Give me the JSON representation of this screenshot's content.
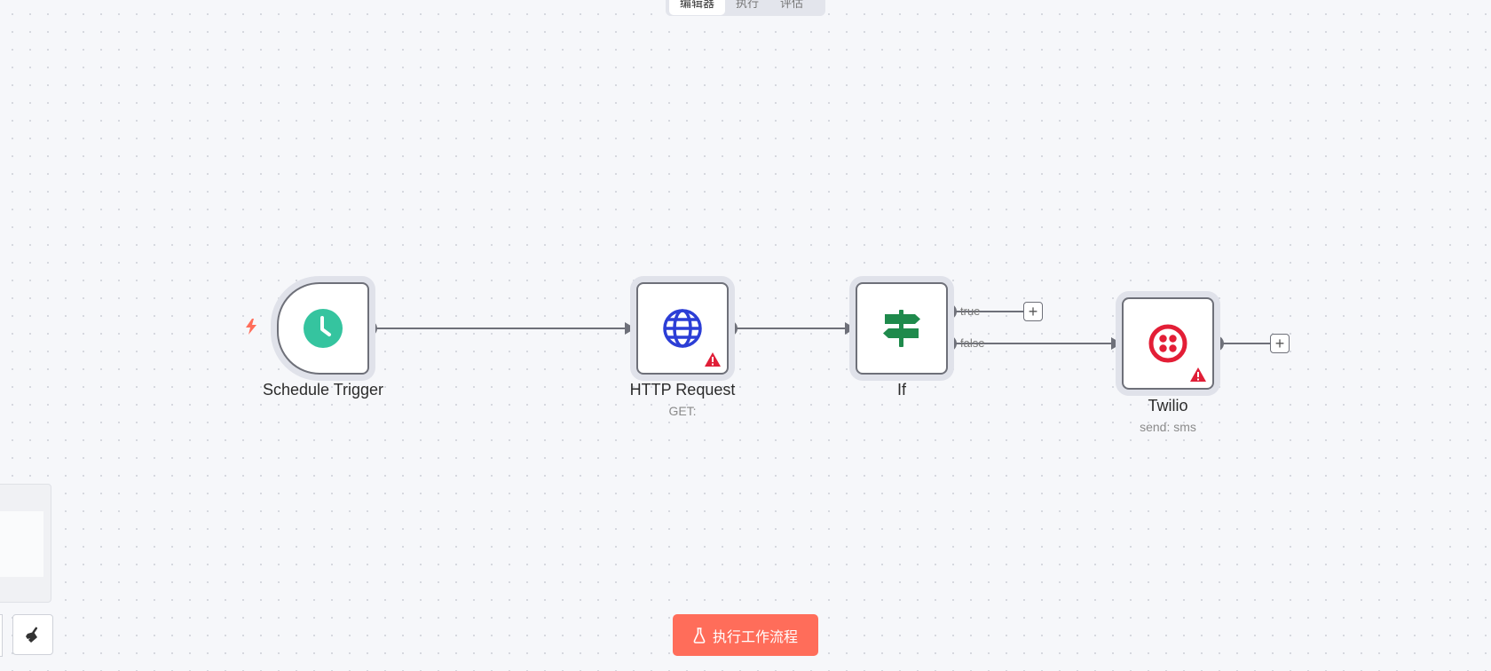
{
  "tabs": [
    {
      "label": "编辑器",
      "active": true
    },
    {
      "label": "执行",
      "active": false
    },
    {
      "label": "评估",
      "active": false
    }
  ],
  "nodes": [
    {
      "id": "schedule",
      "label": "Schedule Trigger",
      "subtitle": "",
      "icon": "clock-icon",
      "warning": false
    },
    {
      "id": "http",
      "label": "HTTP Request",
      "subtitle": "GET:",
      "icon": "globe-icon",
      "warning": true
    },
    {
      "id": "if",
      "label": "If",
      "subtitle": "",
      "icon": "signpost-icon",
      "warning": false
    },
    {
      "id": "twilio",
      "label": "Twilio",
      "subtitle": "send: sms",
      "icon": "twilio-icon",
      "warning": true
    }
  ],
  "branches": {
    "true_label": "true",
    "false_label": "false"
  },
  "execute_button": {
    "label": "执行工作流程",
    "icon": "flask-icon"
  },
  "colors": {
    "accent": "#ff6d5a",
    "schedule_icon": "#35c49f",
    "http_icon": "#2c3ed6",
    "if_icon": "#1f8a4c",
    "twilio_icon": "#e31e36",
    "warning": "#e01e37",
    "connector": "#6e7079"
  }
}
